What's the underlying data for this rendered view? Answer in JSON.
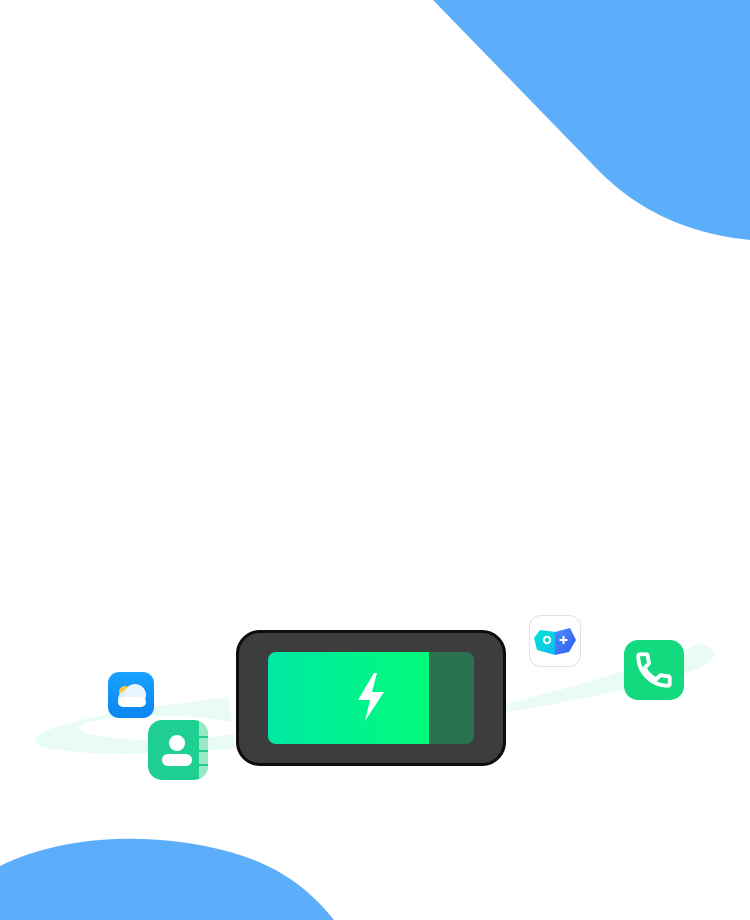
{
  "colors": {
    "blob_blue": "#5caefb",
    "ring_mint": "#e9fcf4",
    "battery_frame": "#3d3d3d",
    "battery_outline": "#0d0d0d",
    "battery_empty": "#2a7350",
    "battery_fill_start": "#00e8a6",
    "battery_fill_end": "#00fa7a",
    "weather_blue": "#0a86f0",
    "contacts_green": "#1fcf92",
    "phone_green": "#13d97f"
  },
  "battery": {
    "level_percent": 78,
    "charging": true,
    "icon": "lightning-bolt-icon"
  },
  "apps": [
    {
      "icon": "weather-icon"
    },
    {
      "icon": "contacts-icon"
    },
    {
      "icon": "game-controller-icon"
    },
    {
      "icon": "phone-icon"
    }
  ]
}
